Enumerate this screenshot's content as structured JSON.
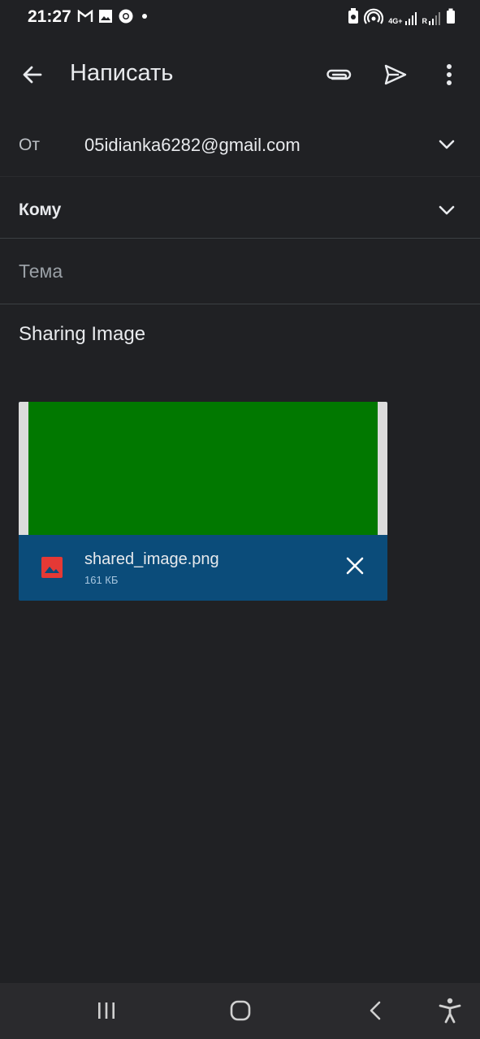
{
  "status_bar": {
    "time": "21:27",
    "left_icons": [
      "gmail-notification-icon",
      "gallery-notification-icon",
      "chrome-notification-icon",
      "dot-icon"
    ],
    "right_icons": [
      "battery-saver-icon",
      "hotspot-icon",
      "signal-4g-icon",
      "signal-roaming-icon",
      "battery-icon"
    ],
    "network_label": "4G+",
    "roaming_label": "R"
  },
  "app_bar": {
    "title": "Написать",
    "icons": [
      "back-arrow-icon",
      "attach-icon",
      "send-icon",
      "more-vert-icon"
    ]
  },
  "compose": {
    "from_label": "От",
    "from_value": "05idianka6282@gmail.com",
    "to_label": "Кому",
    "subject_placeholder": "Тема",
    "body": "Sharing Image"
  },
  "attachment": {
    "file_name": "shared_image.png",
    "file_size": "161 КБ",
    "card_color": "#0b4c7a",
    "thumbnail_color": "#017800",
    "file_icon_color": "#e53935"
  },
  "nav_bar": {
    "icons": [
      "recent-apps-icon",
      "home-icon",
      "back-nav-icon",
      "accessibility-icon"
    ]
  }
}
